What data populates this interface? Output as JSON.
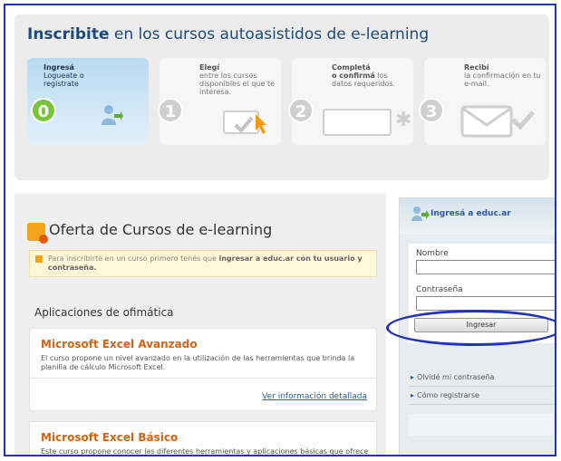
{
  "header": {
    "title_bold": "Inscribite",
    "title_rest": " en los cursos autoasistidos de e-learning",
    "steps": [
      {
        "number": "0",
        "title": "Ingresá",
        "text": "Logueate o registrate"
      },
      {
        "number": "1",
        "title": "Elegí",
        "text": "entre los cursos disponibles el que te interesa."
      },
      {
        "number": "2",
        "title": "Completá",
        "text_bold": "o confirmá",
        "text": "los datos requeridos."
      },
      {
        "number": "3",
        "title": "Recibí",
        "text": "la confirmación en tu e-mail."
      }
    ]
  },
  "main": {
    "offer_title": "Oferta de Cursos de e-learning",
    "notice_text": "Para inscribirte en un curso primero tenés que",
    "notice_bold": "ingresar a educ.ar con tu usuario y contraseña.",
    "section_title": "Aplicaciones de ofimática",
    "courses": [
      {
        "title": "Microsoft Excel Avanzado",
        "desc": "El curso propone un nivel avanzado en la utilización de las herramientas que brinda la planilla de cálculo Microsoft Excel.",
        "link": "Ver información detallada"
      },
      {
        "title": "Microsoft Excel Básico",
        "desc": "Este curso propone conocer las diferentes herramientas y aplicaciones básicas que ofrece la planilla de cálculo, adquieran las habilidades"
      }
    ]
  },
  "login": {
    "header": "Ingresá a educ.ar",
    "name_label": "Nombre",
    "password_label": "Contraseña",
    "submit_label": "Ingresar",
    "links": [
      "Olvidé mi contraseña",
      "Cómo registrarse"
    ]
  },
  "colors": {
    "accent_blue": "#1f4a7a",
    "course_title_orange": "#d8620d",
    "step_active_green": "#7bc43a",
    "highlight_ring": "#2233bb"
  }
}
